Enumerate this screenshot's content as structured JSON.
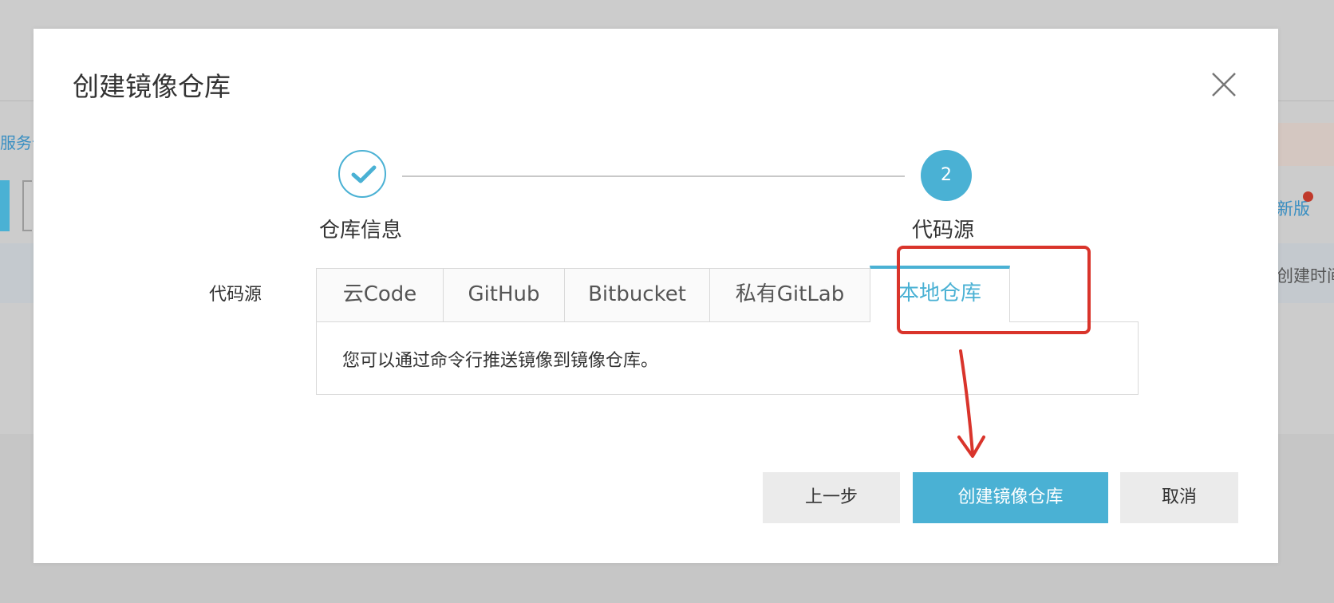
{
  "background": {
    "left_partial_text": "服务仓",
    "right_partial_text": "新版",
    "right_column_text": "创建时间"
  },
  "dialog": {
    "title": "创建镜像仓库",
    "close_icon": "close-icon"
  },
  "steps": [
    {
      "label": "仓库信息",
      "state": "completed",
      "icon": "check-icon"
    },
    {
      "label": "代码源",
      "number": "2",
      "state": "active"
    }
  ],
  "form": {
    "field_label": "代码源",
    "tabs": [
      {
        "label": "云Code",
        "selected": false
      },
      {
        "label": "GitHub",
        "selected": false
      },
      {
        "label": "Bitbucket",
        "selected": false
      },
      {
        "label": "私有GitLab",
        "selected": false
      },
      {
        "label": "本地仓库",
        "selected": true
      }
    ],
    "panel_text": "您可以通过命令行推送镜像到镜像仓库。"
  },
  "footer": {
    "prev_label": "上一步",
    "create_label": "创建镜像仓库",
    "cancel_label": "取消"
  },
  "colors": {
    "accent": "#4ab1d4",
    "annotation": "#d9342b"
  }
}
